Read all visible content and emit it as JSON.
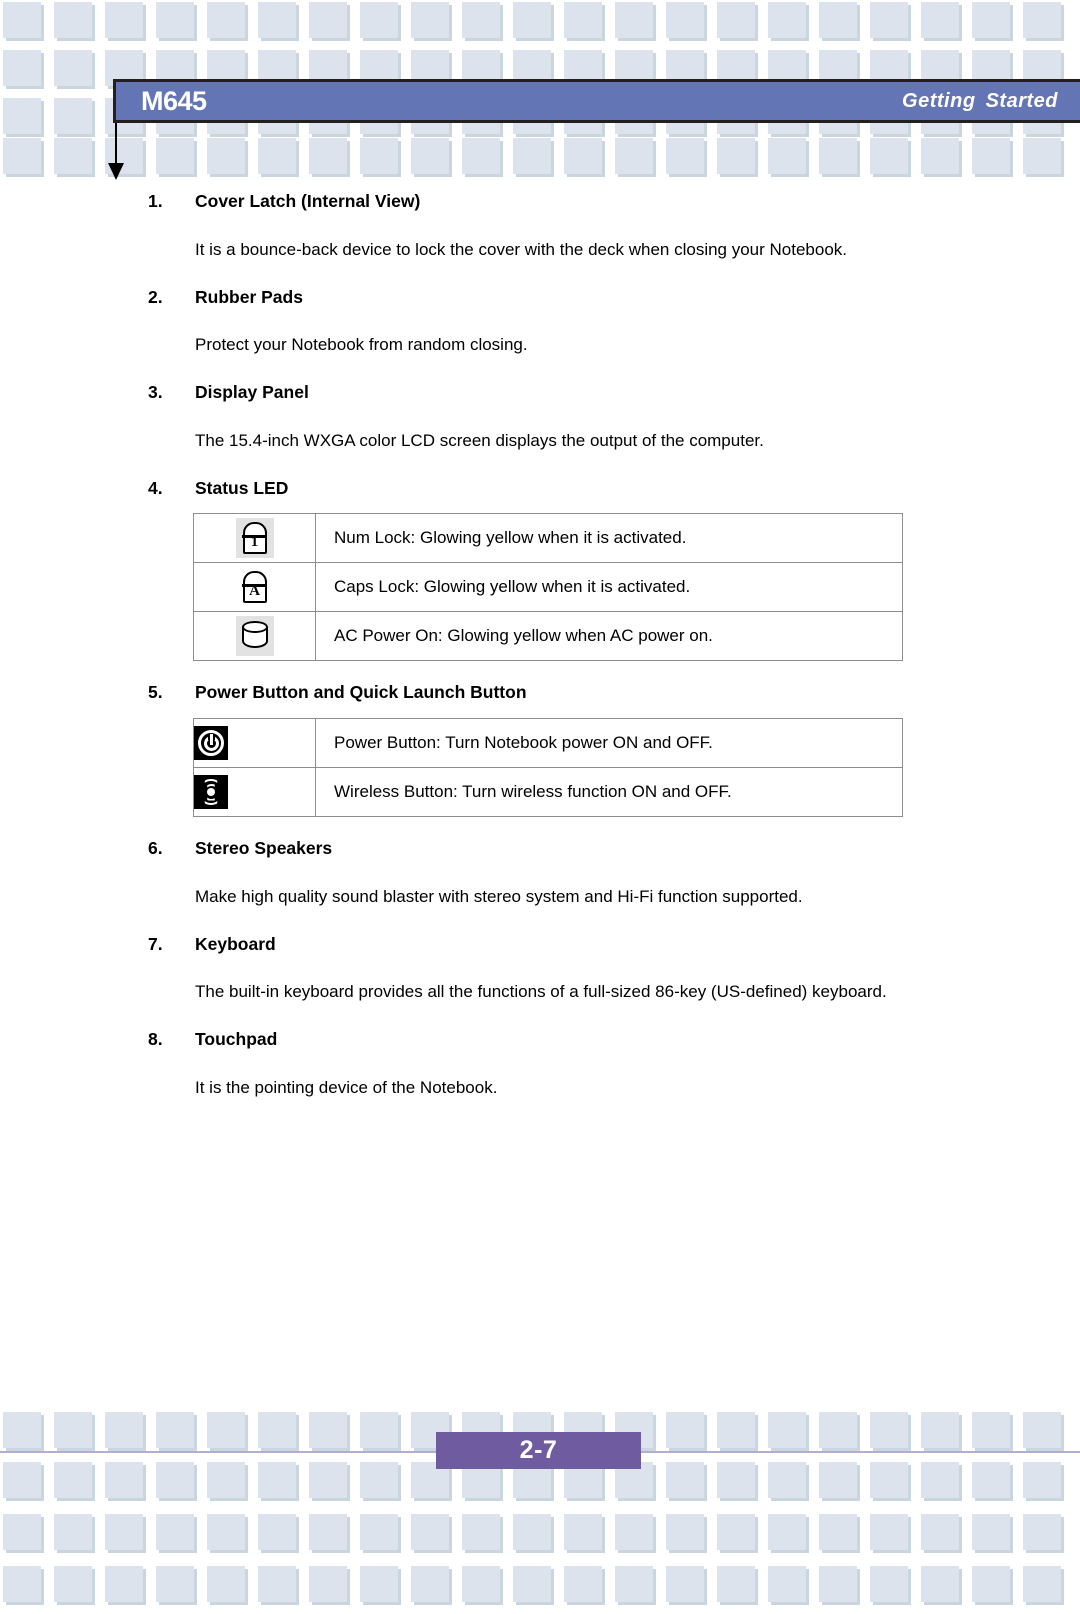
{
  "header": {
    "model": "M645",
    "section": "Getting Started"
  },
  "items": [
    {
      "num": "1.",
      "title": "Cover Latch (Internal View)",
      "body": "It is a bounce-back device to lock the cover with the deck when closing your Notebook."
    },
    {
      "num": "2.",
      "title": "Rubber Pads",
      "body": "Protect your Notebook from random closing."
    },
    {
      "num": "3.",
      "title": "Display Panel",
      "body": "The 15.4-inch WXGA color LCD screen displays the output of the computer."
    },
    {
      "num": "4.",
      "title": "Status LED"
    },
    {
      "num": "5.",
      "title": "Power Button and Quick Launch Button"
    },
    {
      "num": "6.",
      "title": "Stereo Speakers",
      "body": "Make high quality sound blaster with stereo system and Hi-Fi function supported."
    },
    {
      "num": "7.",
      "title": "Keyboard",
      "body": "The built-in keyboard provides all the functions of a full-sized 86-key (US-defined) keyboard."
    },
    {
      "num": "8.",
      "title": "Touchpad",
      "body": "It is the pointing device of the Notebook."
    }
  ],
  "status_led_table": {
    "rows": [
      {
        "icon": "num-lock-icon",
        "glyph": "1",
        "text": "Num Lock: Glowing yellow when it is activated."
      },
      {
        "icon": "caps-lock-icon",
        "glyph": "A",
        "text": "Caps Lock: Glowing yellow when it is activated."
      },
      {
        "icon": "ac-power-cylinder-icon",
        "glyph": "",
        "text": "AC Power On: Glowing yellow when AC power on."
      }
    ]
  },
  "power_button_table": {
    "rows": [
      {
        "icon": "power-button-icon",
        "text": "Power Button: Turn Notebook power ON and OFF."
      },
      {
        "icon": "wireless-button-icon",
        "text": "Wireless Button: Turn wireless function ON and OFF."
      }
    ]
  },
  "footer": {
    "page": "2-7"
  },
  "colors": {
    "header_band": "#6375b4",
    "page_badge": "#6f5ca0",
    "footer_rule": "#b3aed0",
    "pattern_square": "#dde3ec",
    "pattern_shadow": "#c9d6e0"
  }
}
